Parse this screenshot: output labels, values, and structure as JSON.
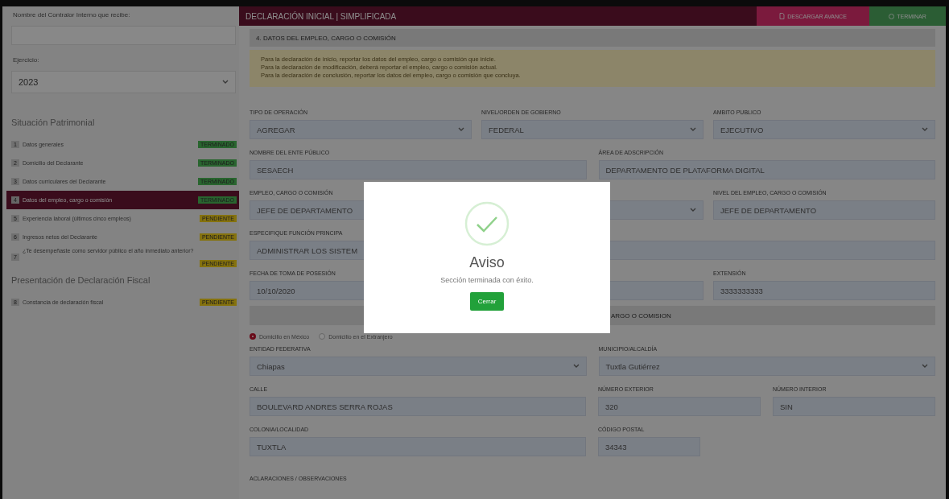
{
  "sidebar": {
    "contralor_label": "Nombre del Contralor Interno que recibe:",
    "ejercicio_label": "Ejercicio:",
    "ejercicio": "2023",
    "sections": [
      {
        "title": "Situación Patrimonial",
        "items": [
          {
            "number": "1",
            "label": "Datos generales",
            "status": "TERMINADO",
            "kind": "done",
            "selected": false
          },
          {
            "number": "2",
            "label": "Domicilio del Declarante",
            "status": "TERMINADO",
            "kind": "done",
            "selected": false
          },
          {
            "number": "3",
            "label": "Datos curriculares del Declarante",
            "status": "TERMINADO",
            "kind": "done",
            "selected": false
          },
          {
            "number": "4",
            "label": "Datos del empleo, cargo o comisión",
            "status": "TERMINADO",
            "kind": "done",
            "selected": true
          },
          {
            "number": "5",
            "label": "Experiencia laboral (últimos cinco empleos)",
            "status": "PENDIENTE",
            "kind": "pending",
            "selected": false
          },
          {
            "number": "6",
            "label": "Ingresos netos del Declarante",
            "status": "PENDIENTE",
            "kind": "pending",
            "selected": false
          },
          {
            "number": "7",
            "label": "¿Te desempeñaste como servidor público el año inmediato anterior?",
            "status": "PENDIENTE",
            "kind": "pending",
            "selected": false
          }
        ]
      },
      {
        "title": "Presentación de Declaración Fiscal",
        "items": [
          {
            "number": "8",
            "label": "Constancia de declaración fiscal",
            "status": "PENDIENTE",
            "kind": "pending",
            "selected": false
          }
        ]
      }
    ]
  },
  "header": {
    "title": "DECLARACIÓN INICIAL | SIMPLIFICADA",
    "buttons": [
      {
        "label": "DESCARGAR AVANCE",
        "kind": "download"
      },
      {
        "label": "TERMINAR",
        "kind": "finish"
      }
    ]
  },
  "section_title": "4. DATOS DEL EMPLEO, CARGO O COMISIÓN",
  "notes": [
    "Para la declaración de inicio, reportar los datos del empleo, cargo o comisión que inicie.",
    "Para la declaración de modificación, deberá reportar el empleo, cargo o comisión actual.",
    "Para la declaración de conclusión, reportar los datos del empleo, cargo o comisión que concluya."
  ],
  "rows": [
    {
      "fields": [
        {
          "label": "TIPO DE OPERACIÓN",
          "value": "AGREGAR",
          "kind": "select"
        },
        {
          "label": "NIVEL/ORDEN DE GOBIERNO",
          "value": "FEDERAL",
          "kind": "select"
        },
        {
          "label": "AMBITO PUBLICO",
          "value": "EJECUTIVO",
          "kind": "select"
        }
      ]
    },
    {
      "fields": [
        {
          "label": "NOMBRE DEL ENTE PÚBLICO",
          "value": "SESAECH",
          "kind": "text"
        },
        {
          "label": "ÁREA DE ADSCRIPCIÓN",
          "value": "DEPARTAMENTO DE PLATAFORMA DIGITAL",
          "kind": "text"
        }
      ]
    },
    {
      "fields": [
        {
          "label": "EMPLEO, CARGO O COMISIÓN",
          "value": "JEFE DE DEPARTAMENTO",
          "kind": "text"
        },
        {
          "kind": "select"
        },
        {
          "label": "NIVEL DEL EMPLEO, CARGO O COMISIÓN",
          "value": "JEFE DE DEPARTAMENTO",
          "kind": "text"
        }
      ]
    },
    {
      "fields": [
        {
          "label": "ESPECIFIQUE FUNCIÓN PRINCIPA",
          "value": "ADMINISTRAR LOS SISTEM",
          "kind": "text"
        }
      ]
    },
    {
      "fields": [
        {
          "label": "FECHA DE TOMA DE POSESIÓN",
          "value": "10/10/2020",
          "kind": "text"
        },
        {
          "kind": "text"
        },
        {
          "label": "EXTENSIÓN",
          "value": "3333333333",
          "kind": "text"
        }
      ]
    }
  ],
  "address": {
    "title": "ARGO O COMISION",
    "radios": [
      {
        "label": "Domicilio en México",
        "selected": true
      },
      {
        "label": "Domicilio en el Extranjero",
        "selected": false
      }
    ],
    "rows": [
      {
        "fields": [
          {
            "label": "ENTIDAD FEDERATIVA",
            "value": "Chiapas",
            "kind": "select"
          },
          {
            "label": "MUNICIPIO/ALCALDÍA",
            "value": "Tuxtla Gutiérrez",
            "kind": "select"
          }
        ]
      },
      {
        "fields": [
          {
            "label": "CALLE",
            "value": "BOULEVARD ANDRES SERRA ROJAS",
            "kind": "text"
          },
          {
            "label": "NÚMERO EXTERIOR",
            "value": "320",
            "kind": "text"
          },
          {
            "label": "NÚMERO INTERIOR",
            "value": "SIN",
            "kind": "text"
          }
        ]
      },
      {
        "fields": [
          {
            "label": "COLONIA/LOCALIDAD",
            "value": "TUXTLA",
            "kind": "text"
          },
          {
            "label": "CÓDIGO POSTAL",
            "value": "34343",
            "kind": "text"
          }
        ]
      }
    ],
    "remarks_label": "ACLARACIONES / OBSERVACIONES"
  },
  "modal": {
    "title": "Aviso",
    "message": "Sección terminada con éxito.",
    "button": "Cerrar"
  }
}
